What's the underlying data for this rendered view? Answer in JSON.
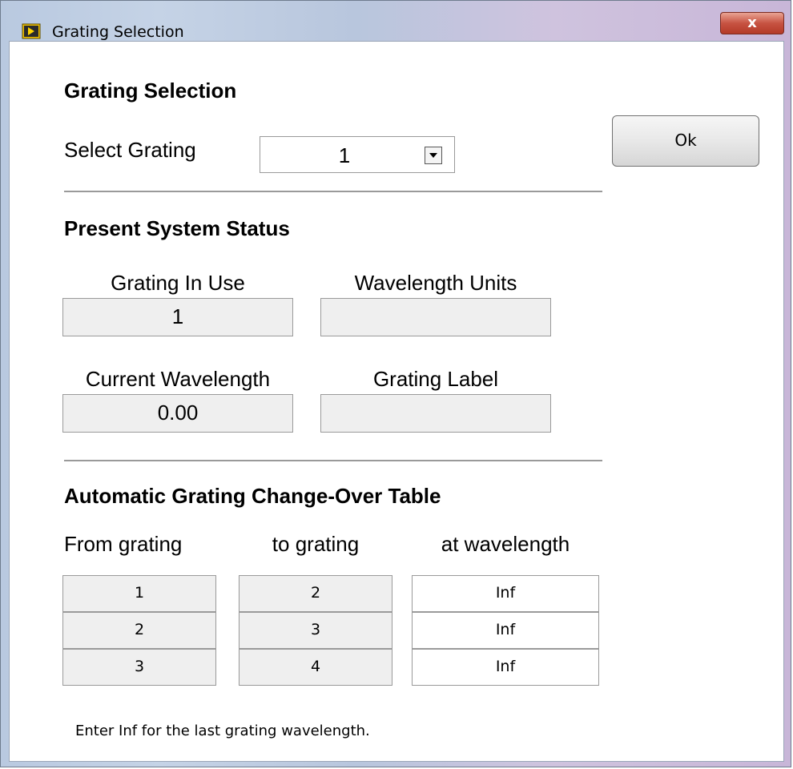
{
  "window": {
    "title": "Grating Selection",
    "close_label": "x"
  },
  "selection": {
    "heading": "Grating Selection",
    "select_label": "Select Grating",
    "select_value": "1",
    "ok_label": "Ok"
  },
  "status": {
    "heading": "Present System Status",
    "grating_in_use_label": "Grating In Use",
    "grating_in_use_value": "1",
    "wavelength_units_label": "Wavelength Units",
    "wavelength_units_value": "",
    "current_wavelength_label": "Current Wavelength",
    "current_wavelength_value": "0.00",
    "grating_label_label": "Grating Label",
    "grating_label_value": ""
  },
  "table": {
    "heading": "Automatic Grating Change-Over Table",
    "headers": [
      "From grating",
      "to grating",
      "at wavelength"
    ],
    "rows": [
      {
        "from": "1",
        "to": "2",
        "at": "Inf"
      },
      {
        "from": "2",
        "to": "3",
        "at": "Inf"
      },
      {
        "from": "3",
        "to": "4",
        "at": "Inf"
      }
    ],
    "note": "Enter Inf for the last grating wavelength."
  }
}
